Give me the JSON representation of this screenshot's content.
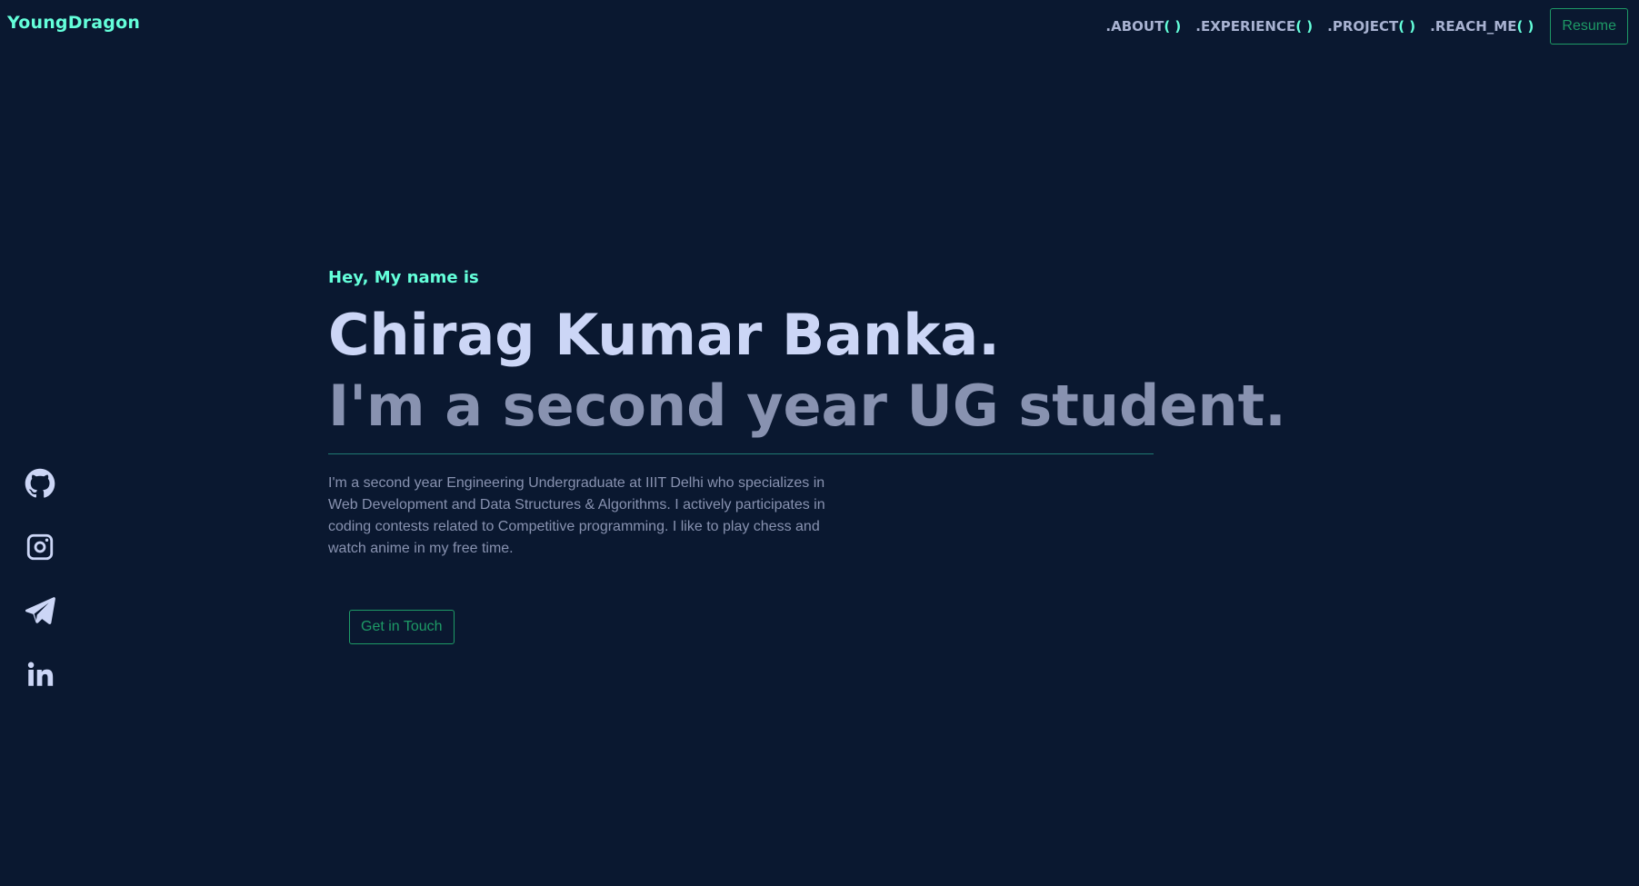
{
  "header": {
    "logo": "YoungDragon",
    "nav": [
      {
        "label": ".ABOUT",
        "parens": "( )"
      },
      {
        "label": ".EXPERIENCE",
        "parens": "( )"
      },
      {
        "label": ".PROJECT",
        "parens": "( )"
      },
      {
        "label": ".REACH_ME",
        "parens": "( )"
      }
    ],
    "resume_label": "Resume"
  },
  "hero": {
    "greeting": "Hey, My name is",
    "name": "Chirag Kumar Banka.",
    "tagline": "I'm a second year UG student.",
    "bio": "I'm a second year Engineering Undergraduate at IIIT Delhi who specializes in Web Development and Data Structures & Algorithms. I actively participates in coding contests related to Competitive programming. I like to play chess and watch anime in my free time.",
    "cta_label": "Get in Touch"
  },
  "socials": [
    {
      "icon": "github-icon"
    },
    {
      "icon": "instagram-icon"
    },
    {
      "icon": "telegram-icon"
    },
    {
      "icon": "linkedin-icon"
    }
  ],
  "colors": {
    "background": "#0a1830",
    "accent": "#64ffda",
    "heading": "#ccd6f6",
    "muted": "#8892b0",
    "button": "#1e9a66"
  }
}
